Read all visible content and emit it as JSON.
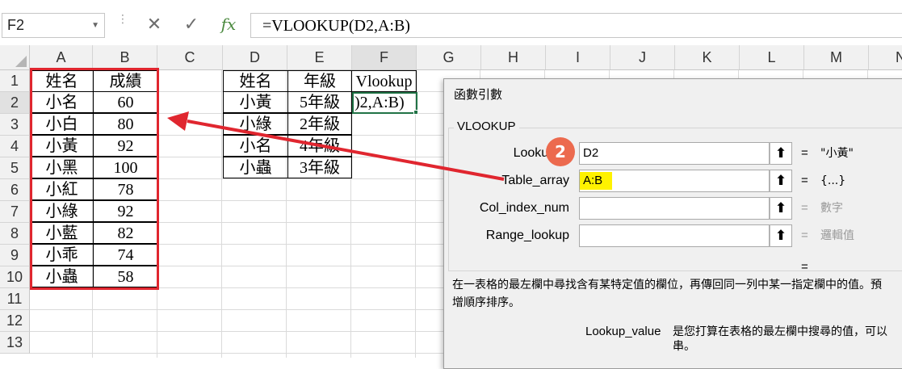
{
  "formula_bar": {
    "name_box": "F2",
    "cancel_icon": "✕",
    "enter_icon": "✓",
    "fx_label": "fx",
    "formula": "=VLOOKUP(D2,A:B)"
  },
  "columns": [
    "A",
    "B",
    "C",
    "D",
    "E",
    "F",
    "G",
    "H",
    "I",
    "J",
    "K",
    "L",
    "M",
    "N"
  ],
  "rows": [
    "1",
    "2",
    "3",
    "4",
    "5",
    "6",
    "7",
    "8",
    "9",
    "10",
    "11",
    "12",
    "13"
  ],
  "table1": {
    "header": [
      "姓名",
      "成績"
    ],
    "rows": [
      [
        "小名",
        "60"
      ],
      [
        "小白",
        "80"
      ],
      [
        "小黃",
        "92"
      ],
      [
        "小黑",
        "100"
      ],
      [
        "小紅",
        "78"
      ],
      [
        "小綠",
        "92"
      ],
      [
        "小藍",
        "82"
      ],
      [
        "小乖",
        "74"
      ],
      [
        "小蟲",
        "58"
      ]
    ]
  },
  "table2": {
    "header": [
      "姓名",
      "年級"
    ],
    "rows": [
      [
        "小黃",
        "5年級"
      ],
      [
        "小綠",
        "2年級"
      ],
      [
        "小名",
        "4年級"
      ],
      [
        "小蟲",
        "3年級"
      ]
    ]
  },
  "f1_value": "Vlookup",
  "f2_value": ")2,A:B)",
  "dialog": {
    "title": "函數引數",
    "function_name": "VLOOKUP",
    "args": [
      {
        "label": "Lookup_v",
        "value": "D2",
        "result": "\"小黃\""
      },
      {
        "label": "Table_array",
        "value": "A:B",
        "result": "{...}"
      },
      {
        "label": "Col_index_num",
        "value": "",
        "result": "數字"
      },
      {
        "label": "Range_lookup",
        "value": "",
        "result": "邏輯值"
      }
    ],
    "collapse_icon": "⬆",
    "equals": "=",
    "description_line1": "在一表格的最左欄中尋找含有某特定值的欄位，再傳回同一列中某一指定欄中的值。預",
    "description_line2": "增順序排序。",
    "detail_label": "Lookup_value",
    "detail_line1": "是您打算在表格的最左欄中搜尋的值，可以",
    "detail_line2": "串。"
  },
  "step_badge": "2",
  "colors": {
    "highlight": "#e0262f",
    "arrow": "#e0262f",
    "badge": "#ec6a4e",
    "yellow": "#fff200",
    "active_cell": "#217346"
  }
}
